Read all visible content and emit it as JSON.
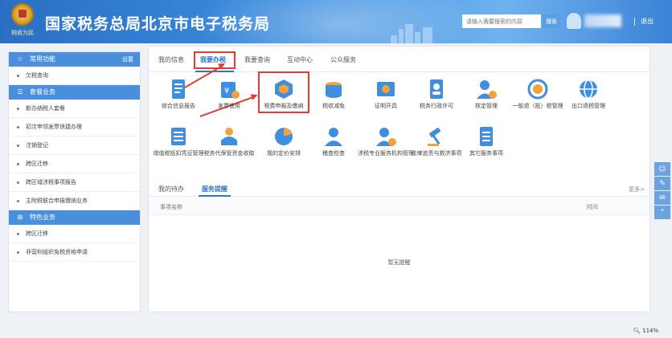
{
  "header": {
    "title": "国家税务总局北京市电子税务局",
    "logo_motto": "税收为民",
    "search_placeholder": "请输入需要搜索的内容",
    "search_button": "搜索",
    "logout": "退出"
  },
  "sidebar": {
    "common": {
      "label": "常用功能",
      "settings": "设置",
      "items": [
        "欠税查询"
      ]
    },
    "package": {
      "label": "套餐业务",
      "items": [
        "新办纳税人套餐",
        "初次申领发票快捷办理",
        "注销登记",
        "跨区迁移",
        "跨区域涉税事项报告",
        "主附税联合申报缴纳业务"
      ]
    },
    "special": {
      "label": "特色业务",
      "items": [
        "跨区迁移",
        "非营利组织免税资格申请"
      ]
    }
  },
  "tabs": [
    "我的信息",
    "我要办税",
    "我要查询",
    "互动中心",
    "公众服务"
  ],
  "grid": [
    {
      "label": "综合信息报告",
      "icon": "document-icon"
    },
    {
      "label": "发票使用",
      "icon": "invoice-icon"
    },
    {
      "label": "税费申报及缴纳",
      "icon": "tax-declaration-icon"
    },
    {
      "label": "税收减免",
      "icon": "tax-reduction-icon"
    },
    {
      "label": "证明开具",
      "icon": "certificate-icon"
    },
    {
      "label": "税务行政许可",
      "icon": "license-icon"
    },
    {
      "label": "核定管理",
      "icon": "approval-icon"
    },
    {
      "label": "一般退（抵）税管理",
      "icon": "refund-icon"
    },
    {
      "label": "出口退税管理",
      "icon": "export-refund-icon"
    },
    {
      "label": "增值税抵扣凭证管理",
      "icon": "vat-voucher-icon"
    },
    {
      "label": "税务代保管资金收取",
      "icon": "fund-custody-icon"
    },
    {
      "label": "我的定价安排",
      "icon": "pricing-icon"
    },
    {
      "label": "稽查检查",
      "icon": "inspection-icon"
    },
    {
      "label": "涉税专业服务机构管理",
      "icon": "agency-icon"
    },
    {
      "label": "法律追责与救济事项",
      "icon": "law-icon"
    },
    {
      "label": "其它服务事项",
      "icon": "other-services-icon"
    }
  ],
  "sub_tabs": [
    "我的待办",
    "服务提醒"
  ],
  "more": "更多>",
  "table": {
    "col_name": "事项名称",
    "col_time": "时间",
    "empty": "暂无提醒"
  },
  "status": {
    "zoom": "114%"
  },
  "colors": {
    "header_blue": "#2a6fc4",
    "accent": "#2f74c8",
    "annotation_red": "#e23c35"
  }
}
